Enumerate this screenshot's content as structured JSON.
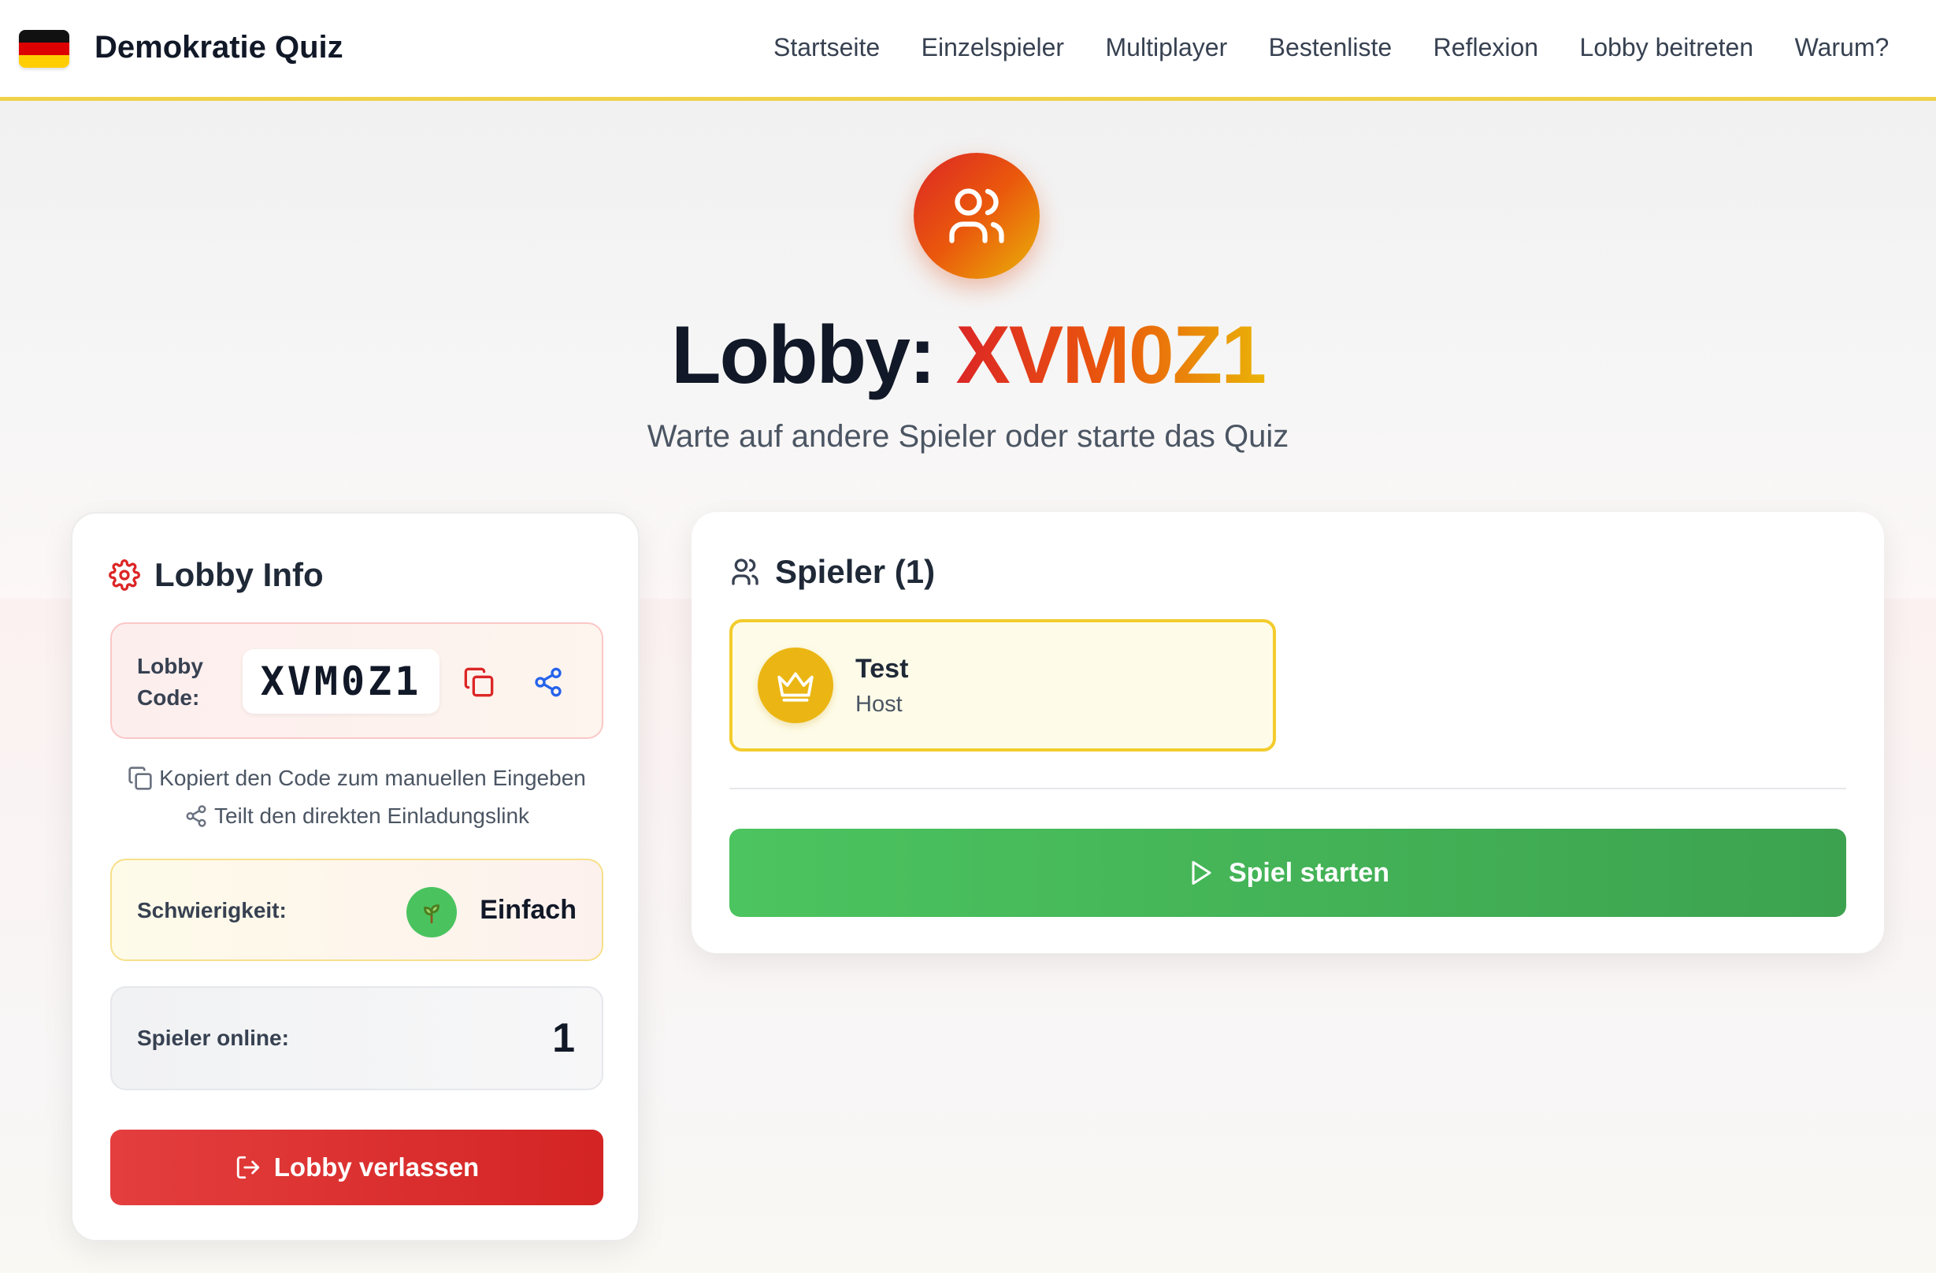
{
  "nav": {
    "brand": "Demokratie Quiz",
    "links": [
      "Startseite",
      "Einzelspieler",
      "Multiplayer",
      "Bestenliste",
      "Reflexion",
      "Lobby beitreten",
      "Warum?"
    ]
  },
  "hero": {
    "title_prefix": "Lobby: ",
    "code": "XVM0Z1",
    "subtitle": "Warte auf andere Spieler oder starte das Quiz",
    "icon": "users-icon"
  },
  "lobby_info": {
    "title": "Lobby Info",
    "code_label": "Lobby Code:",
    "code": "XVM0Z1",
    "hint_copy": "Kopiert den Code zum manuellen Eingeben",
    "hint_share": "Teilt den direkten Einladungslink",
    "difficulty_label": "Schwierigkeit:",
    "difficulty_value": "Einfach",
    "online_label": "Spieler online:",
    "online_value": "1",
    "leave_label": "Lobby verlassen"
  },
  "players": {
    "title": "Spieler (1)",
    "list": [
      {
        "name": "Test",
        "role": "Host"
      }
    ],
    "start_label": "Spiel starten"
  },
  "colors": {
    "accent_red": "#dc2626",
    "accent_orange": "#ea580c",
    "accent_gold": "#eab308",
    "start_green": "#45b85a",
    "leave_red": "#dc2626"
  }
}
